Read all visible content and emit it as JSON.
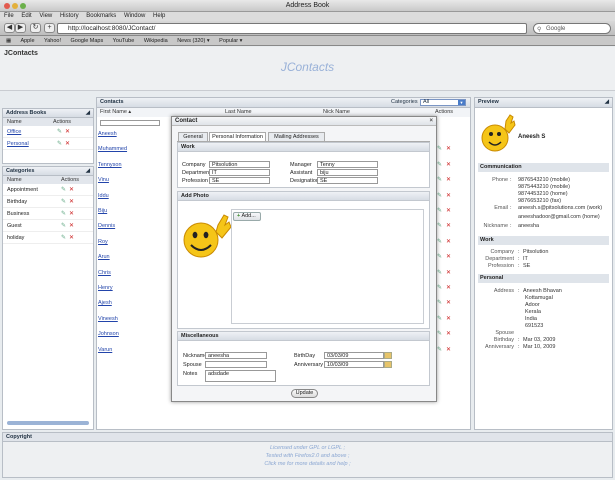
{
  "browser": {
    "window_title": "Address Book",
    "menu": [
      "File",
      "Edit",
      "View",
      "History",
      "Bookmarks",
      "Window",
      "Help"
    ],
    "url": "http://localhost:8080/JContact/",
    "search_placeholder": "Google",
    "bookmarks": [
      "Apple",
      "Yahoo!",
      "Google Maps",
      "YouTube",
      "Wikipedia",
      "News (320) ▾",
      "Popular ▾"
    ]
  },
  "app": {
    "name": "JContacts",
    "logo": "JContacts"
  },
  "address_books": {
    "title": "Address Books",
    "col_name": "Name",
    "col_actions": "Actions",
    "items": [
      "Office",
      "Personal"
    ]
  },
  "categories": {
    "title": "Categories",
    "col_name": "Name",
    "col_actions": "Actions",
    "items": [
      "Appointment",
      "Birthday",
      "Business",
      "Guest",
      "holiday"
    ]
  },
  "contacts": {
    "title": "Contacts",
    "categories_label": "Categories",
    "categories_value": "All",
    "col_first": "First Name ▴",
    "col_last": "Last Name",
    "col_nick": "Nick Name",
    "col_actions": "Actions",
    "names": [
      "Aneesh",
      "Muhammed",
      "Tennyson",
      "Vinu",
      "Iddu",
      "Biju",
      "Dennis",
      "Roy",
      "Arun",
      "Chris",
      "Henry",
      "Ajesh",
      "Vineesh",
      "Johnson",
      "Varun"
    ]
  },
  "dialog": {
    "title": "Contact",
    "close": "×",
    "tabs": [
      "General",
      "Personal Information",
      "Mailing Addresses"
    ],
    "work": {
      "title": "Work",
      "company_label": "Company",
      "company": "Pitsolution",
      "department_label": "Department",
      "department": "IT",
      "profession_label": "Profession",
      "profession": "SE",
      "manager_label": "Manager",
      "manager": "Tenny",
      "assistant_label": "Assistant",
      "assistant": "biju",
      "designation_label": "Designation",
      "designation": "SE"
    },
    "photo": {
      "title": "Add Photo",
      "add_label": "Add..."
    },
    "misc": {
      "title": "Miscellaneous",
      "nickname_label": "Nickname",
      "nickname": "aneesha",
      "spouse_label": "Spouse",
      "spouse": "",
      "notes_label": "Notes",
      "notes": "adsdade",
      "birthday_label": "BirthDay",
      "birthday": "03/03/09",
      "anniversary_label": "Anniversary",
      "anniversary": "10/03/09"
    },
    "update_label": "Update"
  },
  "preview": {
    "title": "Preview",
    "name": "Aneesh S",
    "communication_title": "Communication",
    "phone_label": "Phone",
    "phones": [
      "9876543210 (mobile)",
      "9875443210 (mobile)",
      "9874453210 (home)",
      "9876653210 (fax)"
    ],
    "email_label": "Email",
    "emails": [
      "aneesh.s@pitsolutions.com (work)",
      "aneeshadoor@gmail.com (home)"
    ],
    "nickname_label": "Nickname",
    "nickname": "aneesha",
    "work_title": "Work",
    "company_label": "Company",
    "company": "Pitsolution",
    "department_label": "Department",
    "department": "IT",
    "profession_label": "Profession",
    "profession": "SE",
    "personal_title": "Personal",
    "address_label": "Address",
    "address": [
      "Aneesh Bhavan",
      "Kottamugal",
      "Adoor",
      "Kerala",
      "India",
      "691523"
    ],
    "spouse_label": "Spouse",
    "spouse": "",
    "birthday_label": "Birthday",
    "birthday": "Mar 03, 2009",
    "anniversary_label": "Anniversary",
    "anniversary": "Mar 10, 2009"
  },
  "footer": {
    "title": "Copyright",
    "lines": [
      "Licensed under GPL or LGPL ;",
      "Tested with Firefox2.0 and above ;",
      "Click me for more details and help ;"
    ]
  }
}
